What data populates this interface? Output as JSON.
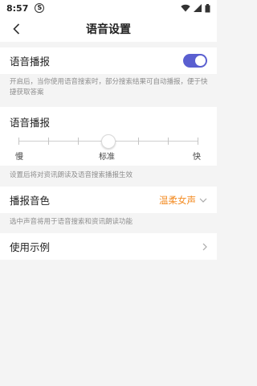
{
  "status_bar": {
    "time": "8:57",
    "app_icon": "S"
  },
  "header": {
    "title": "语音设置",
    "back_icon": "back-arrow-icon"
  },
  "voice_toggle": {
    "label": "语音播报",
    "enabled": true
  },
  "voice_toggle_hint": "开启后，当你使用语音搜索时，部分搜索结果可自动播报，便于快捷获取答案",
  "speed": {
    "label": "语音播报",
    "options": [
      "慢",
      "标准",
      "快"
    ],
    "selected": "标准",
    "steps": 7,
    "selected_step": 3
  },
  "speed_hint": "设置后将对资讯朗读及语音搜索播报生效",
  "voice_tone": {
    "label": "播报音色",
    "value": "温柔女声"
  },
  "voice_tone_hint": "选中声音将用于语音搜索和资讯朗读功能",
  "examples": {
    "label": "使用示例"
  },
  "colors": {
    "accent": "#5a5fd0",
    "value_orange": "#f38b22"
  }
}
